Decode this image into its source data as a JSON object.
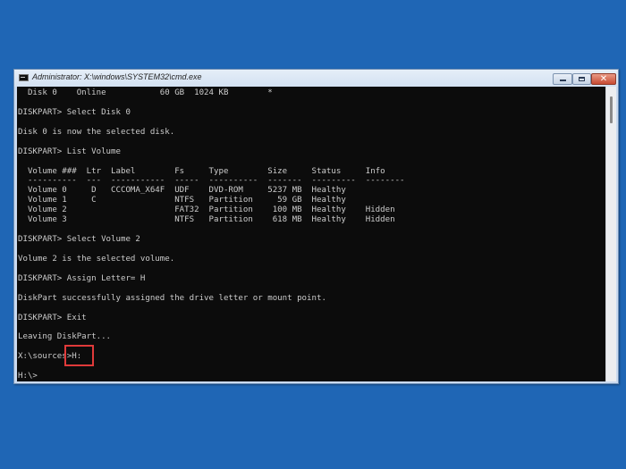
{
  "window": {
    "title": "Administrator: X:\\windows\\SYSTEM32\\cmd.exe",
    "icon": "cmd-icon",
    "buttons": {
      "minimize": "minimize-icon",
      "maximize": "maximize-icon",
      "close": "close-icon",
      "close_glyph": "✕"
    }
  },
  "console": {
    "lines": [
      "  Disk 0    Online           60 GB  1024 KB        *",
      "",
      "DISKPART> Select Disk 0",
      "",
      "Disk 0 is now the selected disk.",
      "",
      "DISKPART> List Volume",
      "",
      "  Volume ###  Ltr  Label        Fs     Type        Size     Status     Info",
      "  ----------  ---  -----------  -----  ----------  -------  ---------  --------",
      "  Volume 0     D   CCCOMA_X64F  UDF    DVD-ROM     5237 MB  Healthy",
      "  Volume 1     C                NTFS   Partition     59 GB  Healthy",
      "  Volume 2                      FAT32  Partition    100 MB  Healthy    Hidden",
      "  Volume 3                      NTFS   Partition    618 MB  Healthy    Hidden",
      "",
      "DISKPART> Select Volume 2",
      "",
      "Volume 2 is the selected volume.",
      "",
      "DISKPART> Assign Letter= H",
      "",
      "DiskPart successfully assigned the drive letter or mount point.",
      "",
      "DISKPART> Exit",
      "",
      "Leaving DiskPart...",
      "",
      "X:\\sources>H:",
      "",
      "H:\\>"
    ],
    "highlighted_command": "H:",
    "highlight_color": "#e03a3a"
  },
  "volume_table": {
    "columns": [
      "Volume ###",
      "Ltr",
      "Label",
      "Fs",
      "Type",
      "Size",
      "Status",
      "Info"
    ],
    "rows": [
      [
        "Volume 0",
        "D",
        "CCCOMA_X64F",
        "UDF",
        "DVD-ROM",
        "5237 MB",
        "Healthy",
        ""
      ],
      [
        "Volume 1",
        "C",
        "",
        "NTFS",
        "Partition",
        "59 GB",
        "Healthy",
        ""
      ],
      [
        "Volume 2",
        "",
        "",
        "FAT32",
        "Partition",
        "100 MB",
        "Healthy",
        "Hidden"
      ],
      [
        "Volume 3",
        "",
        "",
        "NTFS",
        "Partition",
        "618 MB",
        "Healthy",
        "Hidden"
      ]
    ]
  },
  "colors": {
    "desktop": "#1f66b5",
    "console_bg": "#0c0c0c",
    "console_text": "#cccccc",
    "close_button": "#c74a32"
  }
}
